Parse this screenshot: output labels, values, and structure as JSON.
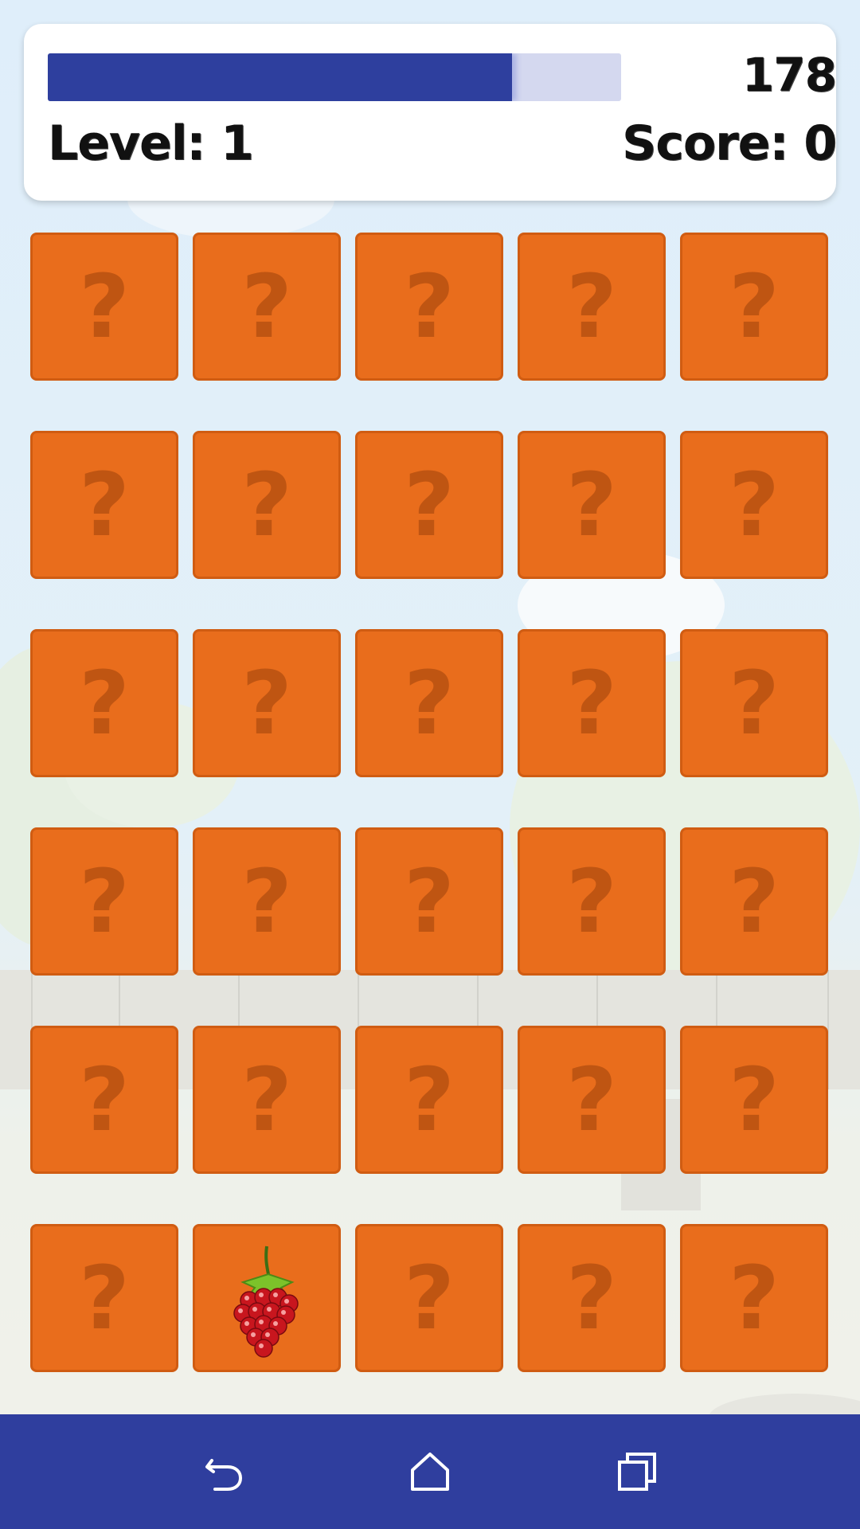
{
  "header": {
    "timer_value": "178",
    "timer_fraction": 0.81,
    "level_label": "Level: 1",
    "score_label": "Score: 0"
  },
  "board": {
    "rows": 6,
    "cols": 5,
    "hidden_symbol": "?",
    "cards": [
      {
        "state": "hidden"
      },
      {
        "state": "hidden"
      },
      {
        "state": "hidden"
      },
      {
        "state": "hidden"
      },
      {
        "state": "hidden"
      },
      {
        "state": "hidden"
      },
      {
        "state": "hidden"
      },
      {
        "state": "hidden"
      },
      {
        "state": "hidden"
      },
      {
        "state": "hidden"
      },
      {
        "state": "hidden"
      },
      {
        "state": "hidden"
      },
      {
        "state": "hidden"
      },
      {
        "state": "hidden"
      },
      {
        "state": "hidden"
      },
      {
        "state": "hidden"
      },
      {
        "state": "hidden"
      },
      {
        "state": "hidden"
      },
      {
        "state": "hidden"
      },
      {
        "state": "hidden"
      },
      {
        "state": "hidden"
      },
      {
        "state": "hidden"
      },
      {
        "state": "hidden"
      },
      {
        "state": "hidden"
      },
      {
        "state": "hidden"
      },
      {
        "state": "hidden"
      },
      {
        "state": "revealed",
        "icon": "raspberry-icon"
      },
      {
        "state": "hidden"
      },
      {
        "state": "hidden"
      },
      {
        "state": "hidden"
      }
    ]
  },
  "navbar": {
    "items": [
      {
        "icon": "back-icon"
      },
      {
        "icon": "home-icon"
      },
      {
        "icon": "recent-apps-icon"
      }
    ]
  },
  "colors": {
    "card": "#e96d1c",
    "card_border": "#d05c12",
    "question_mark": "#bf5512",
    "timer_bar": "#2e3f9e",
    "navbar": "#2f3e9e"
  }
}
